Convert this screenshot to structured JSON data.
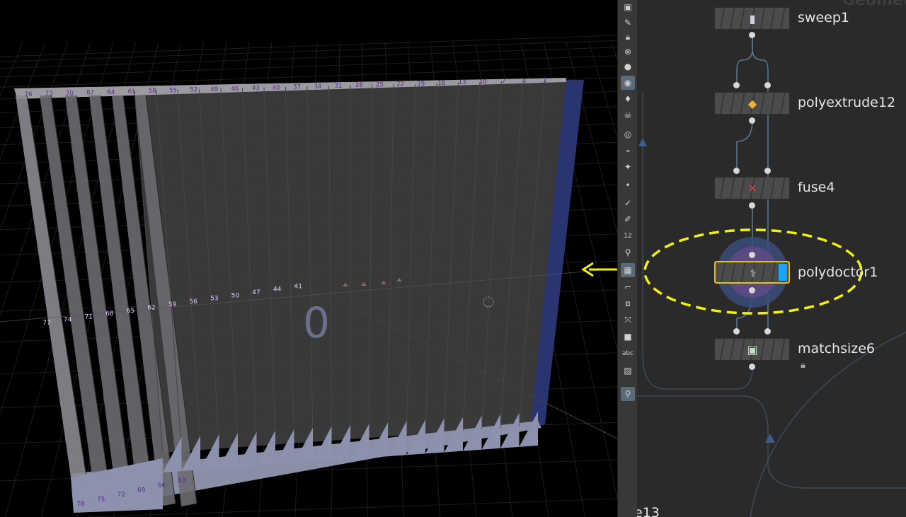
{
  "viewport": {
    "top_numbers": [
      "76",
      "73",
      "70",
      "67",
      "64",
      "61",
      "58",
      "55",
      "52",
      "49",
      "46",
      "43",
      "40",
      "37",
      "34",
      "31",
      "28",
      "25",
      "22",
      "19",
      "16",
      "13",
      "10",
      "7",
      "4",
      "1"
    ],
    "mid_numbers": [
      "77",
      "74",
      "71",
      "68",
      "65",
      "62",
      "59",
      "56",
      "53",
      "50",
      "47",
      "44",
      "41"
    ],
    "bottom_numbers": [
      "78",
      "75",
      "72",
      "69",
      "66",
      "63"
    ],
    "center_glyph": "0"
  },
  "toolbar": {
    "items": [
      "select-icon",
      "edit-icon",
      "lock-icon",
      "close-icon",
      "bulb-icon",
      "sphere-icon",
      "light-icon",
      "bulb-icon",
      "skull-icon",
      "display-icon",
      "brush-icon",
      "paint-icon",
      "dot-icon",
      "check-icon",
      "pen-icon",
      "number-icon",
      "broom-icon",
      "grid-icon",
      "frame-icon",
      "box-icon",
      "axis-icon",
      "stop-icon",
      "text-icon",
      "image-icon",
      "pin-icon"
    ],
    "number_label": "12",
    "text_label": "abc"
  },
  "network": {
    "nodes": [
      {
        "name": "sweep1",
        "icon": "sweep-icon"
      },
      {
        "name": "polyextrude12",
        "icon": "polyextrude-icon"
      },
      {
        "name": "fuse4",
        "icon": "fuse-icon"
      },
      {
        "name": "polydoctor1",
        "icon": "polydoctor-icon"
      },
      {
        "name": "matchsize6",
        "icon": "matchsize-icon"
      }
    ],
    "bottom_label": "e13",
    "top_right_label": "Geomet"
  },
  "colors": {
    "annotation": "#f2f20a",
    "selected_node": "#e6c200",
    "display_flag": "#19a6ff",
    "network_bg": "#2a2a2a",
    "wire": "#5a7a90"
  }
}
